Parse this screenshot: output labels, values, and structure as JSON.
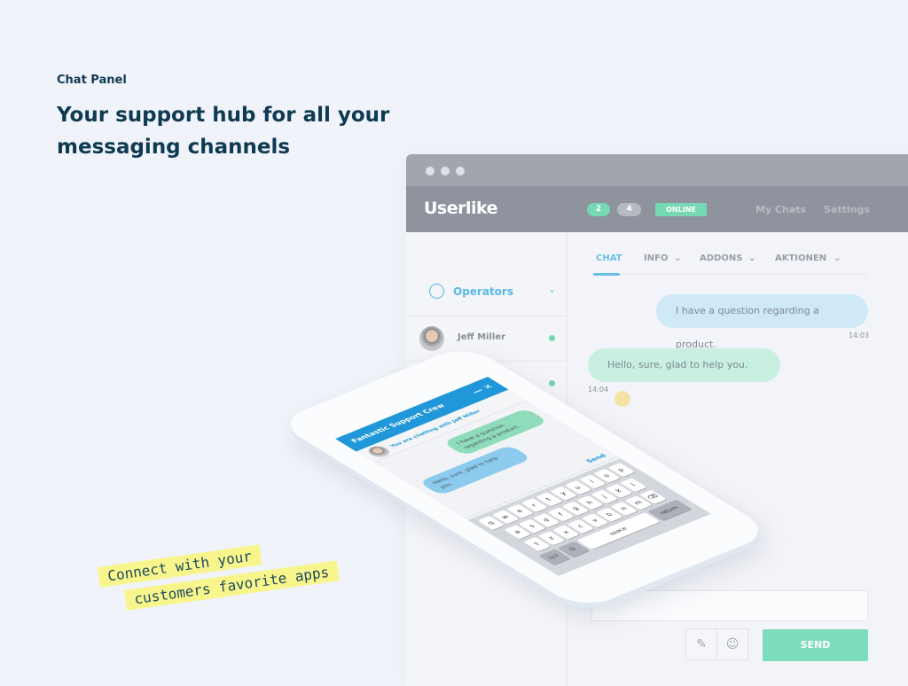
{
  "hero": {
    "kicker": "Chat Panel",
    "headline": "Your support hub for all your messaging channels"
  },
  "app": {
    "logo": "Userlike",
    "badges": [
      "2",
      "4"
    ],
    "status": "ONLINE",
    "nav": [
      "My Chats",
      "Settings"
    ],
    "sidebar": {
      "section": "Operators",
      "operators": [
        {
          "name": "Jeff Miller",
          "online": true
        },
        {
          "name": "",
          "online": true
        }
      ]
    },
    "tabs": [
      {
        "label": "CHAT",
        "active": true
      },
      {
        "label": "INFO"
      },
      {
        "label": "ADDONS"
      },
      {
        "label": "AKTIONEN"
      }
    ],
    "messages": [
      {
        "text": "I have a question regarding a product.",
        "time": "14:03",
        "side": "right"
      },
      {
        "text": "Hello, sure, glad to help you.",
        "time": "14:04",
        "side": "left"
      }
    ],
    "send_label": "SEND",
    "icons": [
      "pencil-icon",
      "smiley-icon"
    ]
  },
  "phone": {
    "title": "Fantastic Support Crew",
    "subtitle": "You are chatting with Jeff Miller",
    "messages": [
      "I have a question regarding a product.",
      "Hello, sure, glad to help you."
    ],
    "send": "Send",
    "keys": [
      [
        "q",
        "w",
        "e",
        "r",
        "t",
        "y",
        "u",
        "i",
        "o",
        "p"
      ],
      [
        "a",
        "s",
        "d",
        "f",
        "g",
        "h",
        "j",
        "k",
        "l"
      ],
      [
        "⇧",
        "z",
        "x",
        "c",
        "v",
        "b",
        "n",
        "m",
        "⌫"
      ]
    ],
    "num": "123",
    "space": "space",
    "return": "return"
  },
  "note": {
    "line1": "Connect with your",
    "line2": "customers favorite apps"
  },
  "colors": {
    "brand_dark": "#0e3a52",
    "accent_blue": "#67bde6",
    "green": "#7bddbb",
    "phone_blue": "#1f97d8",
    "note_yellow": "#f8f58c"
  }
}
